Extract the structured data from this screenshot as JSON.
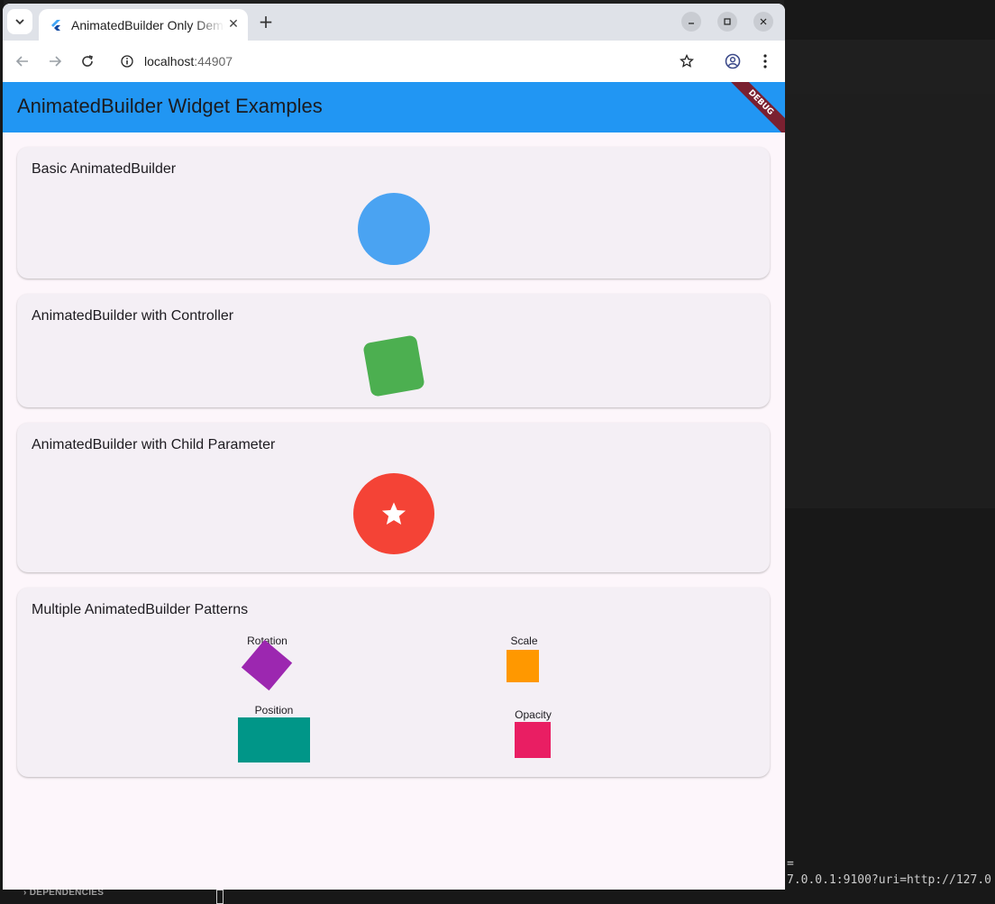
{
  "browser": {
    "tab_title": "AnimatedBuilder Only Demo",
    "url_host": "localhost",
    "url_port": ":44907"
  },
  "app": {
    "title": "AnimatedBuilder Widget Examples",
    "debug_banner": "DEBUG",
    "primary_color": "#2196f3"
  },
  "cards": [
    {
      "title": "Basic AnimatedBuilder",
      "shape": "circle",
      "color": "#4aa3f2"
    },
    {
      "title": "AnimatedBuilder with Controller",
      "shape": "rotated-rounded-square",
      "color": "#4caf50"
    },
    {
      "title": "AnimatedBuilder with Child Parameter",
      "shape": "circle-with-star-icon",
      "color": "#f44336"
    },
    {
      "title": "Multiple AnimatedBuilder Patterns",
      "patterns": [
        {
          "label": "Rotation",
          "color": "#9c27b0"
        },
        {
          "label": "Scale",
          "color": "#ff9800"
        },
        {
          "label": "Position",
          "color": "#009688"
        },
        {
          "label": "Opacity",
          "color": "#e91e63"
        }
      ]
    }
  ],
  "background": {
    "terminal_lines": "=\n7.0.0.1:9100?uri=http://127.0",
    "panel_label": "DEPENDENCIES"
  }
}
